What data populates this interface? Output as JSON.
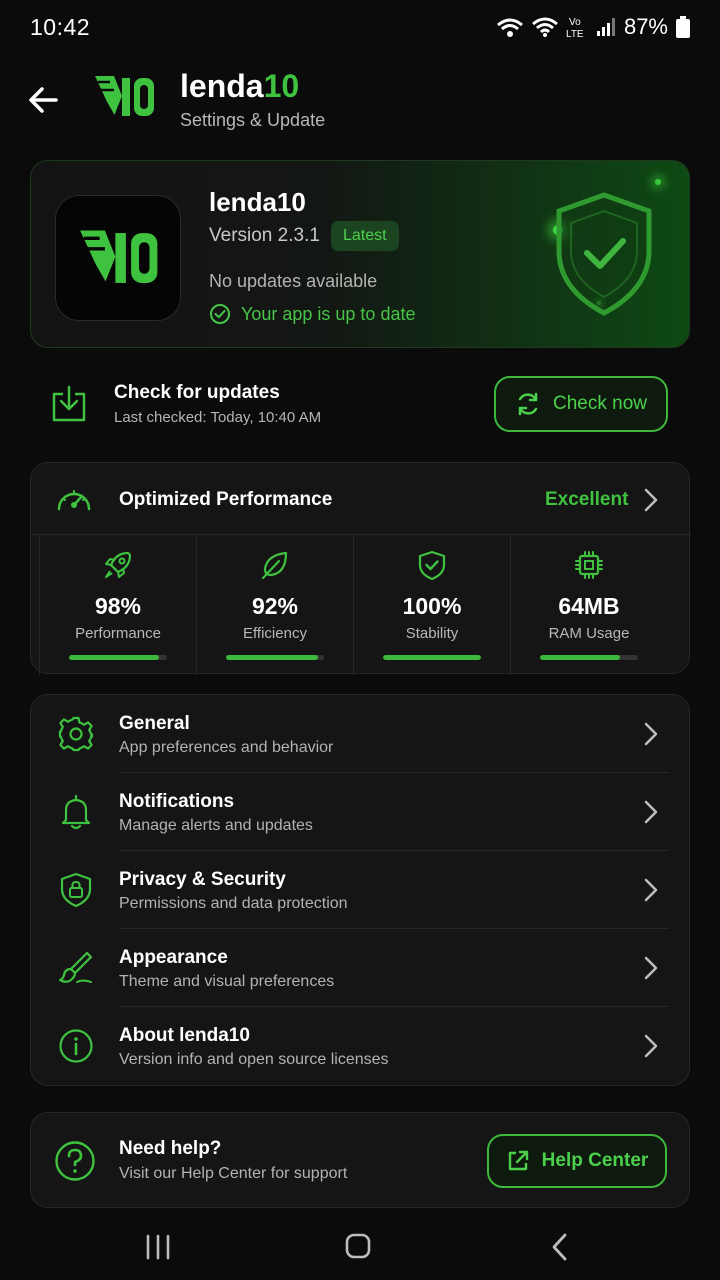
{
  "status_bar": {
    "time": "10:42",
    "battery": "87%",
    "network": "LTE"
  },
  "header": {
    "title_main": "lenda",
    "title_accent": "10",
    "subtitle": "Settings & Update",
    "logo_text": "10"
  },
  "app_info": {
    "name": "lenda10",
    "version": "Version 2.3.1",
    "badge": "Latest",
    "update_status": "No updates available",
    "up_to_date": "Your app is up to date"
  },
  "update_check": {
    "title": "Check for updates",
    "last_checked": "Last checked: Today, 10:40 AM",
    "button_label": "Check now"
  },
  "performance": {
    "title": "Optimized Performance",
    "rating": "Excellent",
    "stats": [
      {
        "icon": "rocket-icon",
        "value": "98%",
        "label": "Performance",
        "fill": 0.92
      },
      {
        "icon": "leaf-icon",
        "value": "92%",
        "label": "Efficiency",
        "fill": 0.94
      },
      {
        "icon": "shield-check-icon",
        "value": "100%",
        "label": "Stability",
        "fill": 1.0
      },
      {
        "icon": "chip-icon",
        "value": "64MB",
        "label": "RAM Usage",
        "fill": 0.82
      }
    ]
  },
  "menu": {
    "items": [
      {
        "icon": "gear-icon",
        "title": "General",
        "subtitle": "App preferences and behavior"
      },
      {
        "icon": "bell-icon",
        "title": "Notifications",
        "subtitle": "Manage alerts and updates"
      },
      {
        "icon": "shield-lock-icon",
        "title": "Privacy & Security",
        "subtitle": "Permissions and data protection"
      },
      {
        "icon": "brush-icon",
        "title": "Appearance",
        "subtitle": "Theme and visual preferences"
      },
      {
        "icon": "info-icon",
        "title": "About lenda10",
        "subtitle": "Version info and open source licenses"
      }
    ]
  },
  "help": {
    "title": "Need help?",
    "subtitle": "Visit our Help Center for support",
    "button_label": "Help Center"
  },
  "colors": {
    "accent": "#3fc23f",
    "background": "#0b0b0b",
    "card": "#151515"
  }
}
